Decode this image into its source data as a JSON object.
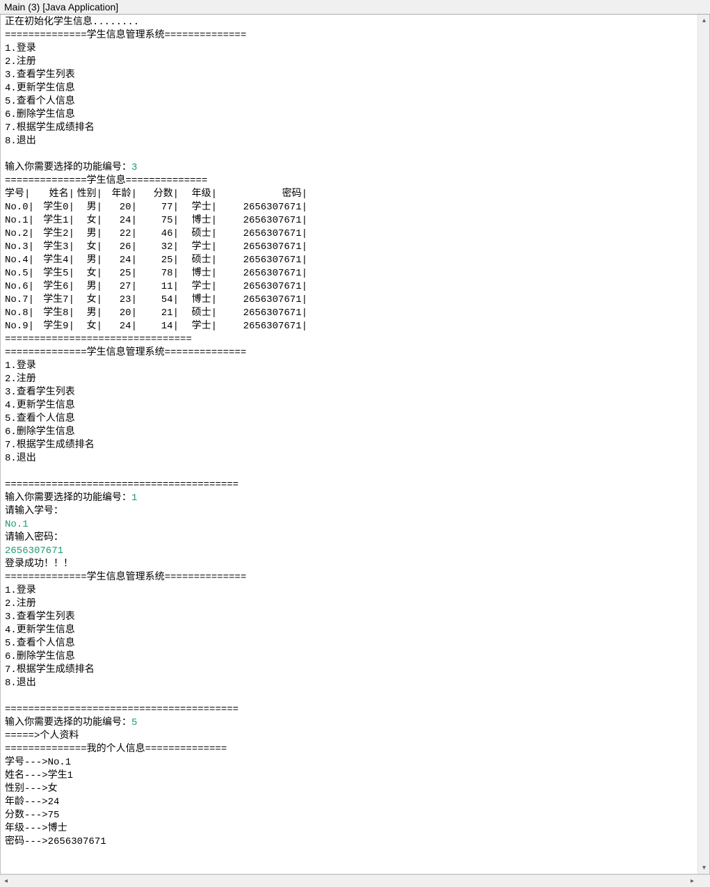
{
  "title": "Main (3) [Java Application]",
  "init_msg": "正在初始化学生信息........",
  "system_banner": "==============学生信息管理系统==============",
  "menu": [
    "1.登录",
    "2.注册",
    "3.查看学生列表",
    "4.更新学生信息",
    "5.查看个人信息",
    "6.删除学生信息",
    "7.根据学生成绩排名",
    "8.退出"
  ],
  "sep_long": "========================================",
  "prompt_func": "输入你需要选择的功能编号：",
  "input1": "3",
  "student_banner": "==============学生信息==============",
  "table": {
    "headers": {
      "no": "学号",
      "name": "姓名",
      "sex": "性别",
      "age": "年龄",
      "score": "分数",
      "grade": "年级",
      "pwd": "密码"
    },
    "rows": [
      {
        "no": "No.0",
        "name": "学生0",
        "sex": "男",
        "age": "20",
        "score": "77",
        "grade": "学士",
        "pwd": "2656307671"
      },
      {
        "no": "No.1",
        "name": "学生1",
        "sex": "女",
        "age": "24",
        "score": "75",
        "grade": "博士",
        "pwd": "2656307671"
      },
      {
        "no": "No.2",
        "name": "学生2",
        "sex": "男",
        "age": "22",
        "score": "46",
        "grade": "硕士",
        "pwd": "2656307671"
      },
      {
        "no": "No.3",
        "name": "学生3",
        "sex": "女",
        "age": "26",
        "score": "32",
        "grade": "学士",
        "pwd": "2656307671"
      },
      {
        "no": "No.4",
        "name": "学生4",
        "sex": "男",
        "age": "24",
        "score": "25",
        "grade": "硕士",
        "pwd": "2656307671"
      },
      {
        "no": "No.5",
        "name": "学生5",
        "sex": "女",
        "age": "25",
        "score": "78",
        "grade": "博士",
        "pwd": "2656307671"
      },
      {
        "no": "No.6",
        "name": "学生6",
        "sex": "男",
        "age": "27",
        "score": "11",
        "grade": "学士",
        "pwd": "2656307671"
      },
      {
        "no": "No.7",
        "name": "学生7",
        "sex": "女",
        "age": "23",
        "score": "54",
        "grade": "博士",
        "pwd": "2656307671"
      },
      {
        "no": "No.8",
        "name": "学生8",
        "sex": "男",
        "age": "20",
        "score": "21",
        "grade": "硕士",
        "pwd": "2656307671"
      },
      {
        "no": "No.9",
        "name": "学生9",
        "sex": "女",
        "age": "24",
        "score": "14",
        "grade": "学士",
        "pwd": "2656307671"
      }
    ]
  },
  "sep_mid": "================================",
  "input2": "1",
  "login_id_prompt": "请输入学号：",
  "login_id_input": "No.1",
  "login_pwd_prompt": "请输入密码：",
  "login_pwd_input": "2656307671",
  "login_success": "登录成功！！！",
  "input3": "5",
  "personal_arrow": "=====>个人资料",
  "personal_banner": "==============我的个人信息==============",
  "personal": {
    "id": "学号--->No.1",
    "name": "姓名--->学生1",
    "sex": "性别--->女",
    "age": "年龄--->24",
    "score": "分数--->75",
    "grade": "年级--->博士",
    "pwd": "密码--->2656307671"
  }
}
